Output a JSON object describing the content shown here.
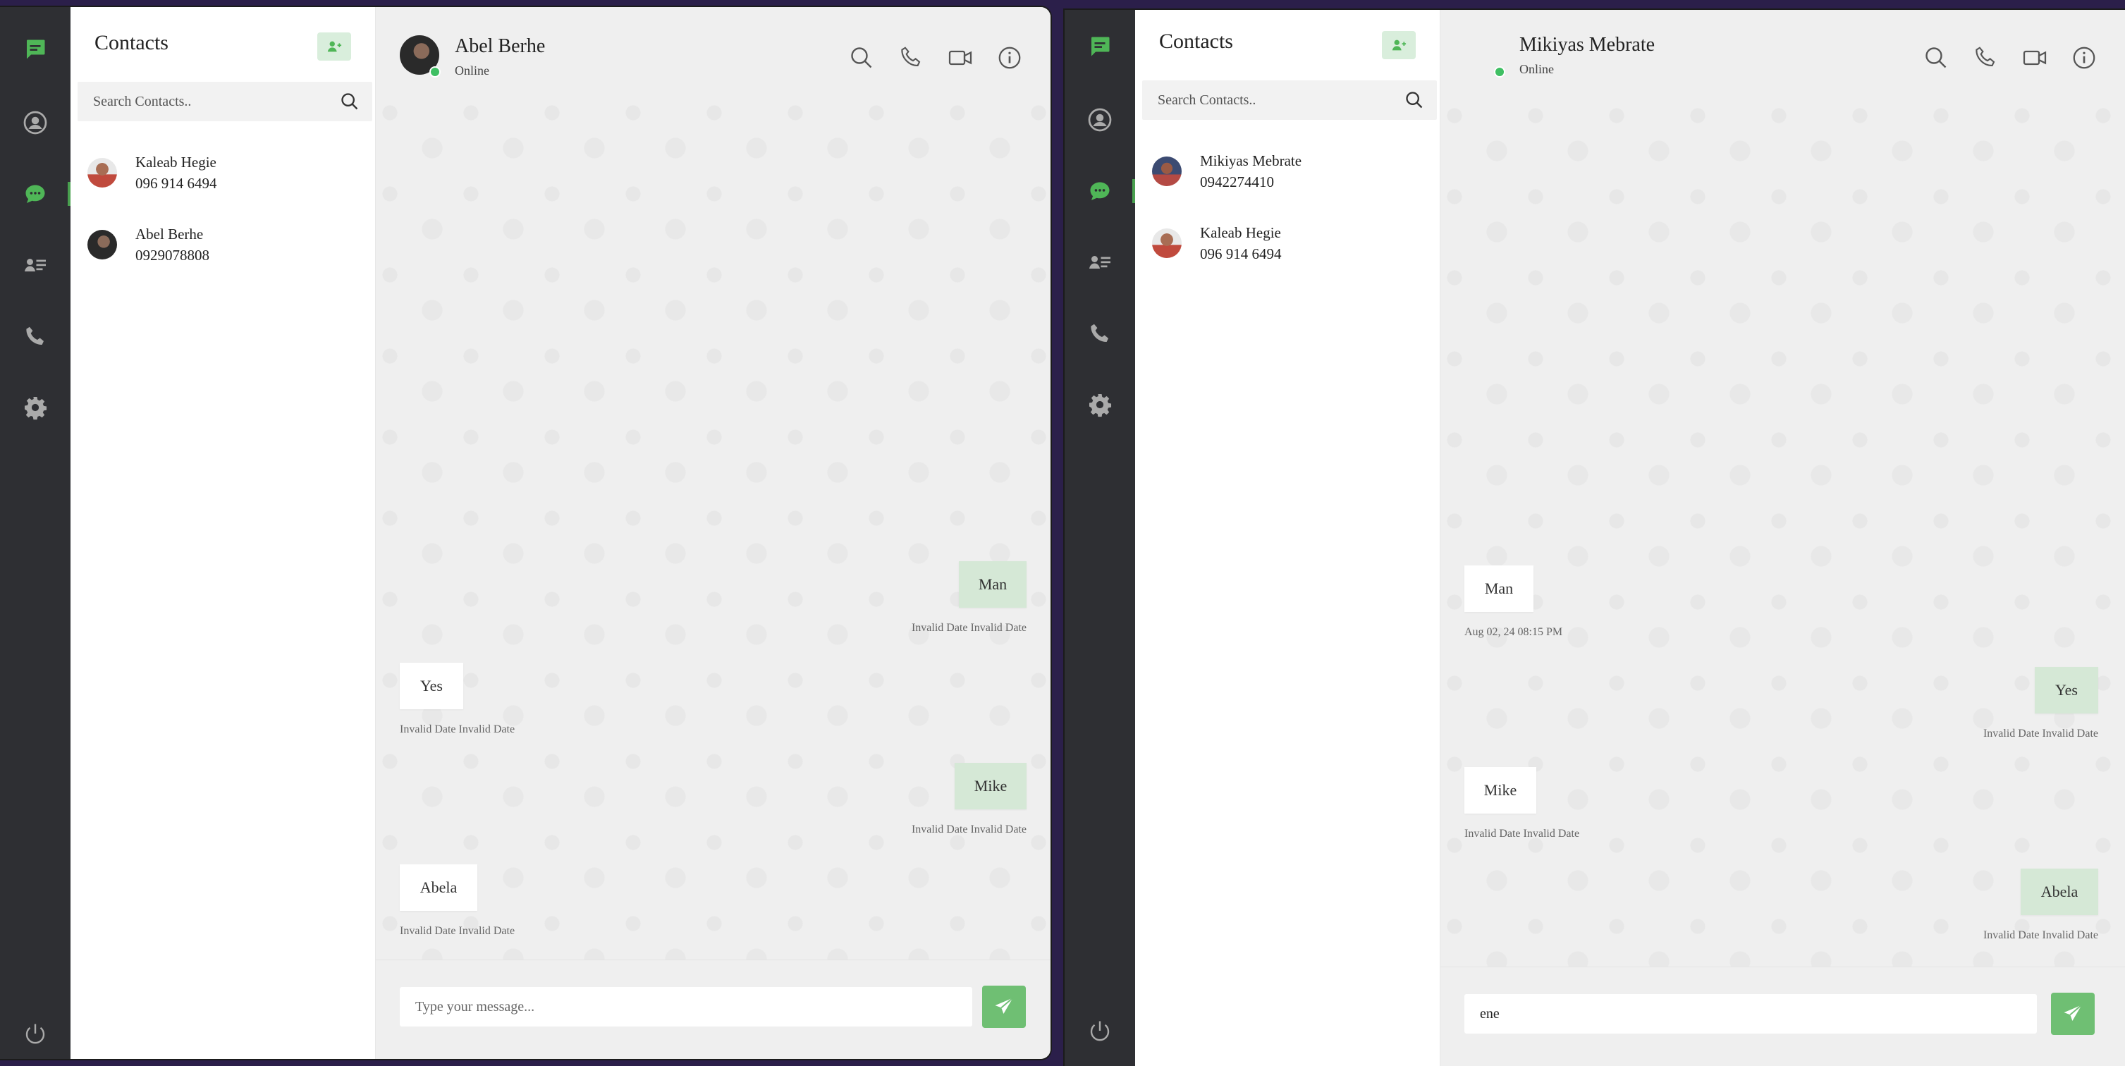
{
  "colors": {
    "rail": "#2e2f33",
    "accent": "#49a04f",
    "outgoing_bubble": "#d5e8d6",
    "send_button": "#6fbf73",
    "online_dot": "#3fbf63"
  },
  "rail_icons": [
    "chat-square-icon",
    "profile-icon",
    "chats-icon",
    "contacts-book-icon",
    "phone-icon",
    "settings-icon",
    "power-icon"
  ],
  "left": {
    "contacts": {
      "title": "Contacts",
      "search_placeholder": "Search Contacts..",
      "items": [
        {
          "name": "Kaleab Hegie",
          "phone": "096 914 6494"
        },
        {
          "name": "Abel Berhe",
          "phone": "0929078808"
        }
      ]
    },
    "chat": {
      "name": "Abel Berhe",
      "status": "Online",
      "messages": [
        {
          "text": "Man",
          "time": "Invalid Date Invalid Date",
          "direction": "out"
        },
        {
          "text": "Yes",
          "time": "Invalid Date Invalid Date",
          "direction": "in"
        },
        {
          "text": "Mike",
          "time": "Invalid Date Invalid Date",
          "direction": "out"
        },
        {
          "text": "Abela",
          "time": "Invalid Date Invalid Date",
          "direction": "in"
        }
      ],
      "composer_value": "",
      "composer_placeholder": "Type your message..."
    }
  },
  "right": {
    "contacts": {
      "title": "Contacts",
      "search_placeholder": "Search Contacts..",
      "items": [
        {
          "name": "Mikiyas Mebrate",
          "phone": "0942274410"
        },
        {
          "name": "Kaleab Hegie",
          "phone": "096 914 6494"
        }
      ]
    },
    "chat": {
      "name": "Mikiyas Mebrate",
      "status": "Online",
      "messages": [
        {
          "text": "Man",
          "time": "Aug 02, 24 08:15 PM",
          "direction": "in"
        },
        {
          "text": "Yes",
          "time": "Invalid Date Invalid Date",
          "direction": "out"
        },
        {
          "text": "Mike",
          "time": "Invalid Date Invalid Date",
          "direction": "in"
        },
        {
          "text": "Abela",
          "time": "Invalid Date Invalid Date",
          "direction": "out"
        }
      ],
      "composer_value": "ene",
      "composer_placeholder": "Type your message..."
    }
  }
}
